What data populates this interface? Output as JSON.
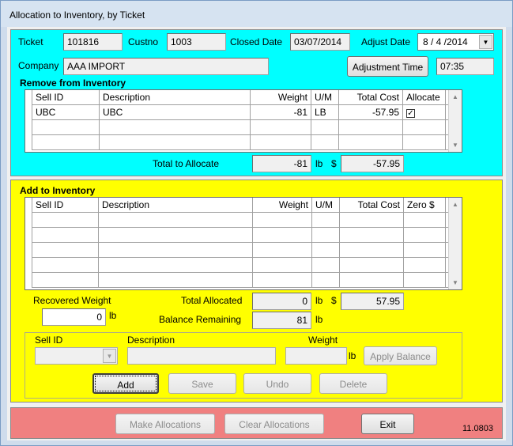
{
  "window": {
    "title": "Allocation to Inventory, by Ticket"
  },
  "ticket": {
    "ticket_label": "Ticket",
    "ticket_value": "101816",
    "custno_label": "Custno",
    "custno_value": "1003",
    "closed_date_label": "Closed Date",
    "closed_date_value": "03/07/2014",
    "adjust_date_label": "Adjust Date",
    "adjust_date_value": "8 / 4 /2014",
    "company_label": "Company",
    "company_value": "AAA IMPORT",
    "adjustment_time_button": "Adjustment Time",
    "adjustment_time_value": "07:35"
  },
  "remove": {
    "title": "Remove from Inventory",
    "columns": [
      "Sell ID",
      "Description",
      "Weight",
      "U/M",
      "Total Cost",
      "Allocate"
    ],
    "rows": [
      {
        "sell_id": "UBC",
        "description": "UBC",
        "weight": "-81",
        "um": "LB",
        "total_cost": "-57.95",
        "allocate": "✓"
      }
    ],
    "total_label": "Total to Allocate",
    "total_weight": "-81",
    "total_unit": "lb",
    "currency": "$",
    "total_cost": "-57.95"
  },
  "add": {
    "title": "Add to Inventory",
    "columns": [
      "Sell ID",
      "Description",
      "Weight",
      "U/M",
      "Total Cost",
      "Zero $"
    ],
    "recovered_weight_label": "Recovered Weight",
    "recovered_weight_value": "0",
    "recovered_unit": "lb",
    "total_allocated_label": "Total Allocated",
    "total_allocated_weight": "0",
    "total_allocated_unit": "lb",
    "currency": "$",
    "total_allocated_cost": "57.95",
    "balance_label": "Balance Remaining",
    "balance_weight": "81",
    "balance_unit": "lb",
    "entry": {
      "sell_id_label": "Sell ID",
      "description_label": "Description",
      "weight_label": "Weight",
      "weight_unit": "lb",
      "apply_balance_button": "Apply Balance"
    },
    "buttons": {
      "add": "Add",
      "save": "Save",
      "undo": "Undo",
      "delete": "Delete"
    }
  },
  "footer": {
    "make_allocations": "Make Allocations",
    "clear_allocations": "Clear Allocations",
    "exit": "Exit",
    "version": "11.0803"
  },
  "colors": {
    "top_panel": "#00ffff",
    "middle_panel": "#ffff00",
    "bottom_panel": "#f08080"
  },
  "icons": [
    "check-icon",
    "chevron-down-icon",
    "scroll-up-icon",
    "scroll-down-icon"
  ]
}
